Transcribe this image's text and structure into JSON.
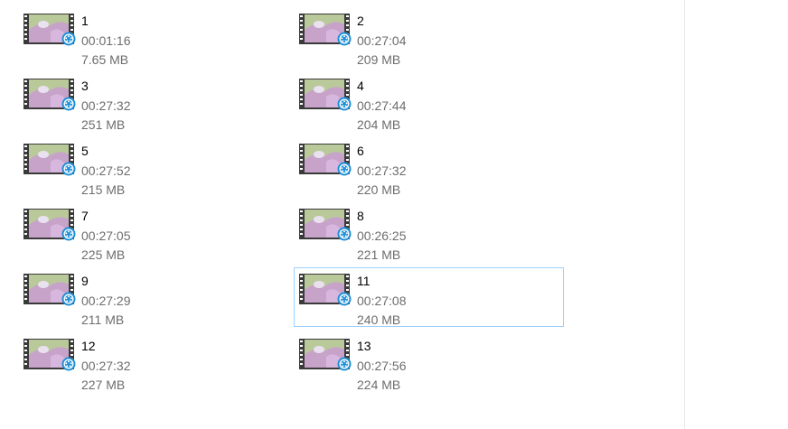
{
  "files": [
    {
      "name": "1",
      "duration": "00:01:16",
      "size": "7.65 MB",
      "selected": false
    },
    {
      "name": "2",
      "duration": "00:27:04",
      "size": "209 MB",
      "selected": false
    },
    {
      "name": "3",
      "duration": "00:27:32",
      "size": "251 MB",
      "selected": false
    },
    {
      "name": "4",
      "duration": "00:27:44",
      "size": "204 MB",
      "selected": false
    },
    {
      "name": "5",
      "duration": "00:27:52",
      "size": "215 MB",
      "selected": false
    },
    {
      "name": "6",
      "duration": "00:27:32",
      "size": "220 MB",
      "selected": false
    },
    {
      "name": "7",
      "duration": "00:27:05",
      "size": "225 MB",
      "selected": false
    },
    {
      "name": "8",
      "duration": "00:26:25",
      "size": "221 MB",
      "selected": false
    },
    {
      "name": "9",
      "duration": "00:27:29",
      "size": "211 MB",
      "selected": false
    },
    {
      "name": "11",
      "duration": "00:27:08",
      "size": "240 MB",
      "selected": true
    },
    {
      "name": "12",
      "duration": "00:27:32",
      "size": "227 MB",
      "selected": false
    },
    {
      "name": "13",
      "duration": "00:27:56",
      "size": "224 MB",
      "selected": false
    }
  ],
  "icons": {
    "thumbnail": "video-thumbnail-icon",
    "player_badge": "media-player-badge-icon"
  },
  "colors": {
    "selection_border": "#99d1ff",
    "filmstrip": "#3a3a3a",
    "badge": "#1e8fd6",
    "text_primary": "#000000",
    "text_secondary": "#6d6d6d"
  }
}
